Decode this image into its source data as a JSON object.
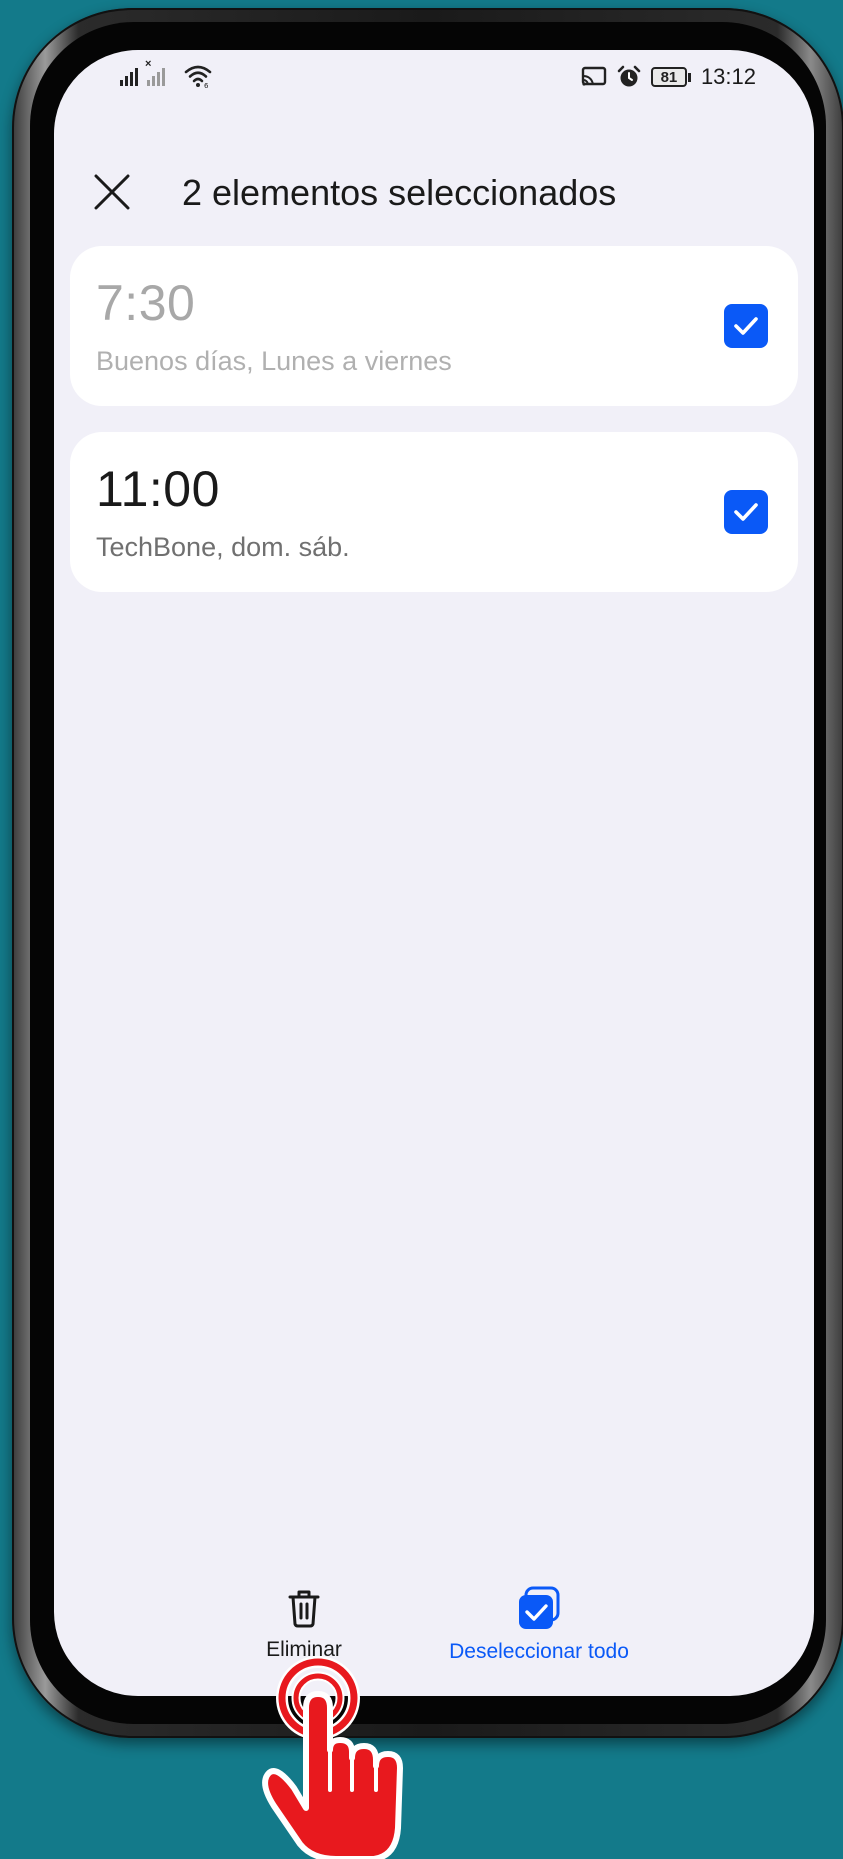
{
  "status_bar": {
    "battery_level": "81",
    "time": "13:12"
  },
  "header": {
    "title": "2 elementos seleccionados"
  },
  "alarms": [
    {
      "time": "7:30",
      "label": "Buenos días, Lunes a viernes",
      "selected": true,
      "enabled": false
    },
    {
      "time": "11:00",
      "label": "TechBone, dom. sáb.",
      "selected": true,
      "enabled": true
    }
  ],
  "bottom_bar": {
    "delete_label": "Eliminar",
    "deselect_label": "Deseleccionar todo"
  },
  "colors": {
    "accent": "#0a59f7",
    "background": "#137a8a",
    "screen": "#f1f0f8",
    "pointer": "#e8191e"
  },
  "icons": {
    "close": "close-icon",
    "checkbox": "checkbox-checked-icon",
    "delete": "trash-icon",
    "deselect": "deselect-all-icon",
    "pointer": "tap-hand-icon"
  }
}
